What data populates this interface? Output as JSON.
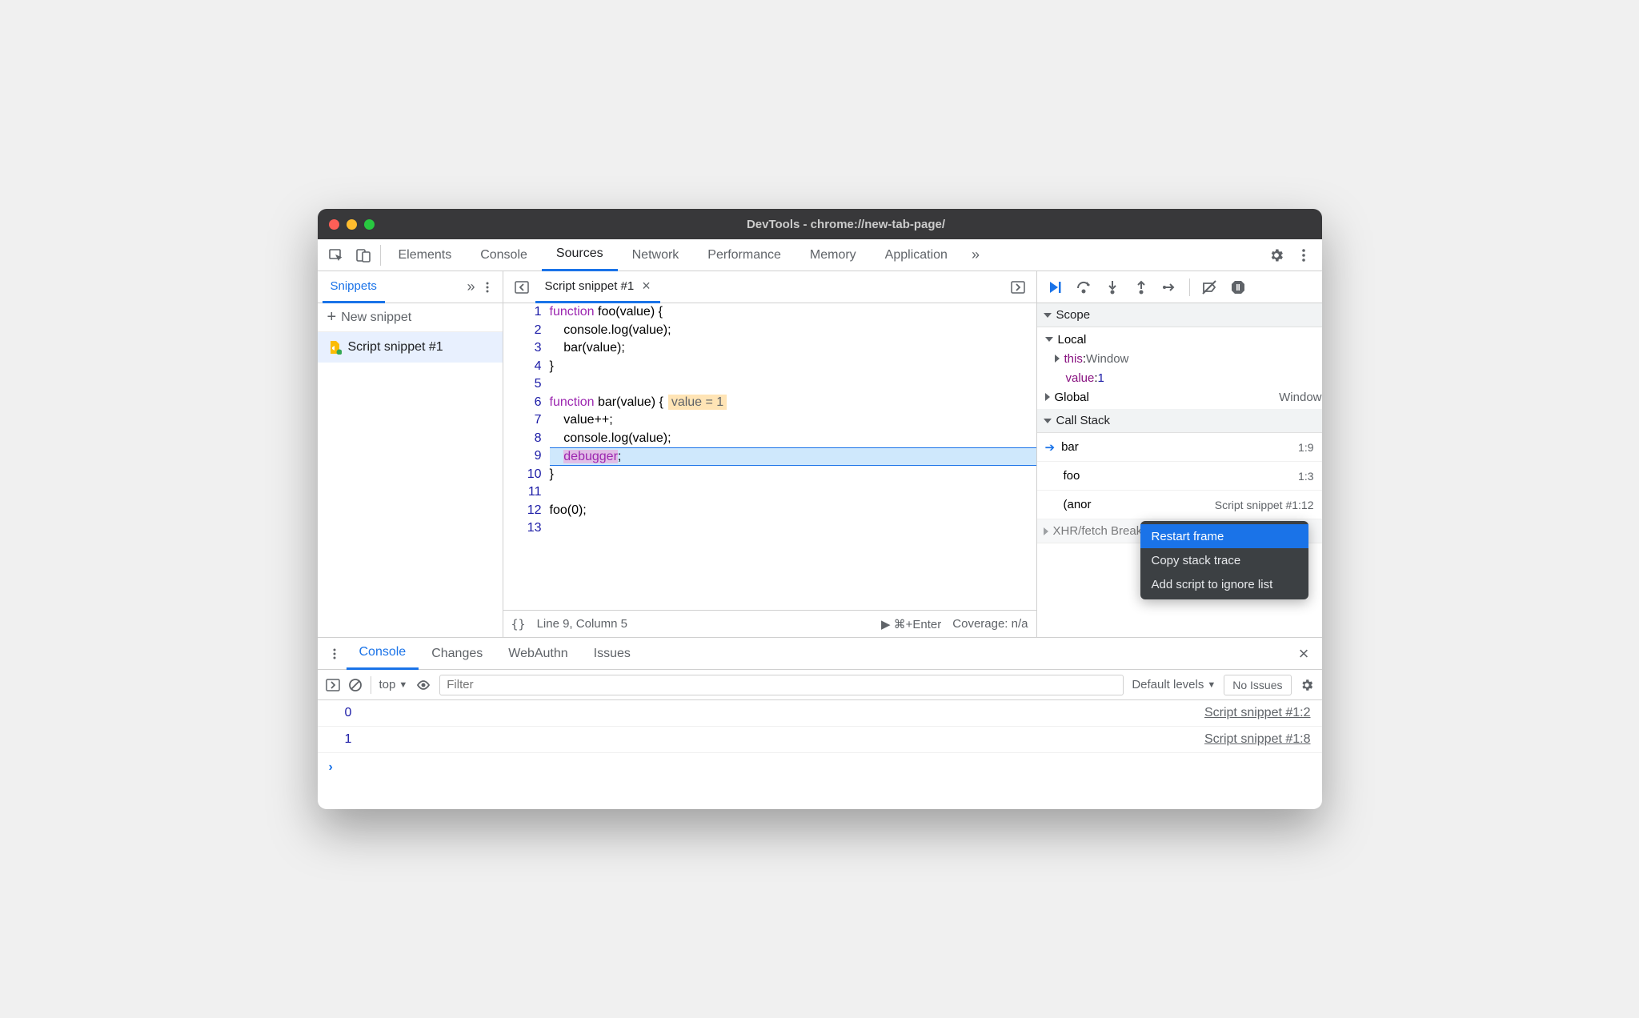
{
  "window": {
    "title": "DevTools - chrome://new-tab-page/"
  },
  "main_tabs": {
    "items": [
      "Elements",
      "Console",
      "Sources",
      "Network",
      "Performance",
      "Memory",
      "Application"
    ],
    "active_index": 2
  },
  "navigator": {
    "active_tab": "Snippets",
    "new_snippet_label": "New snippet",
    "files": [
      "Script snippet #1"
    ]
  },
  "editor": {
    "tabs": [
      {
        "title": "Script snippet #1"
      }
    ],
    "gutter": [
      "1",
      "2",
      "3",
      "4",
      "5",
      "6",
      "7",
      "8",
      "9",
      "10",
      "11",
      "12",
      "13"
    ],
    "inline_value": "value = 1",
    "status": {
      "format_icon": "{}",
      "cursor": "Line 9, Column 5",
      "run_label": "⌘+Enter",
      "coverage": "Coverage: n/a"
    }
  },
  "code": {
    "l1_kw": "function",
    "l1_rest": " foo(value) {",
    "l2": "    console.log(value);",
    "l3": "    bar(value);",
    "l4": "}",
    "l5": "",
    "l6_kw": "function",
    "l6_rest": " bar(value) {",
    "l7": "    value++;",
    "l8": "    console.log(value);",
    "l9_pre": "    ",
    "l9_kw": "debugger",
    "l9_post": ";",
    "l10": "}",
    "l11": "",
    "l12": "foo(0);",
    "l13": ""
  },
  "debugger": {
    "scope_label": "Scope",
    "local_label": "Local",
    "this_label": "this",
    "this_value": "Window",
    "value_label": "value",
    "value_value": "1",
    "global_label": "Global",
    "global_value": "Window",
    "callstack_label": "Call Stack",
    "stack": [
      {
        "fn": "bar",
        "loc": "1:9",
        "current": true
      },
      {
        "fn": "foo",
        "loc": "1:3",
        "current": false
      },
      {
        "fn": "(anor",
        "loc": "Script snippet #1:12",
        "current": false
      }
    ],
    "xhr_label": "XHR/fetch Breakpoints"
  },
  "context_menu": {
    "items": [
      "Restart frame",
      "Copy stack trace",
      "Add script to ignore list"
    ],
    "highlighted": 0
  },
  "drawer": {
    "tabs": [
      "Console",
      "Changes",
      "WebAuthn",
      "Issues"
    ],
    "active_index": 0,
    "toolbar": {
      "context": "top",
      "filter_placeholder": "Filter",
      "levels": "Default levels",
      "issues": "No Issues"
    },
    "logs": [
      {
        "value": "0",
        "source": "Script snippet #1:2"
      },
      {
        "value": "1",
        "source": "Script snippet #1:8"
      }
    ]
  }
}
